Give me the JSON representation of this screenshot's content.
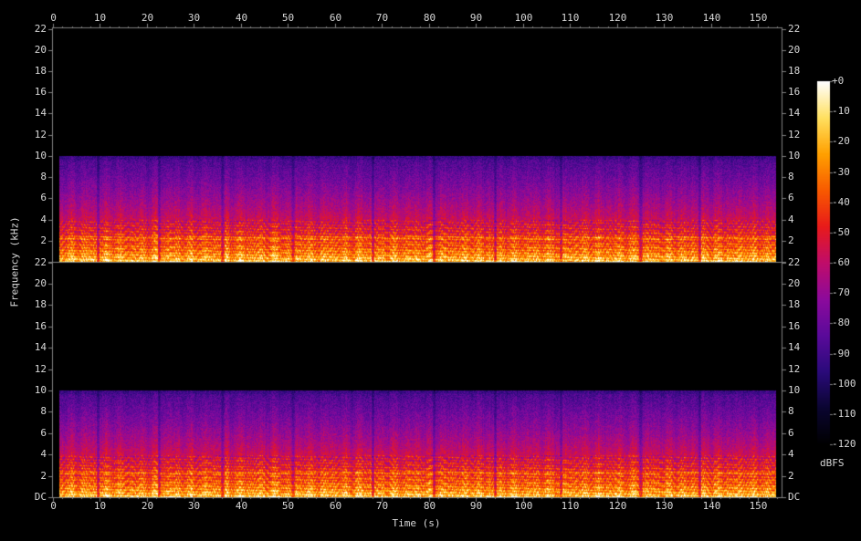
{
  "chart_data": {
    "type": "heatmap",
    "kind": "spectrogram",
    "channels": 2,
    "xlabel": "Time (s)",
    "ylabel": "Frequency (kHz)",
    "x_ticks": [
      0,
      10,
      20,
      30,
      40,
      50,
      60,
      70,
      80,
      90,
      100,
      110,
      120,
      130,
      140,
      150
    ],
    "xlim": [
      0,
      155
    ],
    "y_ticks": [
      "DC",
      "2",
      "4",
      "6",
      "8",
      "10",
      "12",
      "14",
      "16",
      "18",
      "20",
      "22"
    ],
    "y_tick_values": [
      0,
      2,
      4,
      6,
      8,
      10,
      12,
      14,
      16,
      18,
      20,
      22
    ],
    "ylim": [
      0,
      22.05
    ],
    "content_time_range": [
      1.2,
      153.8
    ],
    "content_bandwidth_khz": 10,
    "colorbar": {
      "unit": "dBFS",
      "ticks": [
        "+0",
        "-10",
        "-20",
        "-30",
        "-40",
        "-50",
        "-60",
        "-70",
        "-80",
        "-90",
        "-100",
        "-110",
        "-120"
      ],
      "tick_values": [
        0,
        -10,
        -20,
        -30,
        -40,
        -50,
        -60,
        -70,
        -80,
        -90,
        -100,
        -110,
        -120
      ],
      "range": [
        -120,
        0
      ]
    },
    "pause_times_s": [
      9.5,
      22.5,
      36,
      51,
      68,
      81,
      94,
      108,
      125,
      137.5
    ],
    "colors": {
      "background": "#000000",
      "text": "#d8d8d8",
      "axis": "#808080",
      "palette": [
        "#000000",
        "#0a0530",
        "#2a0a7a",
        "#5a0a9a",
        "#8c0a9c",
        "#c00c6a",
        "#e81a1a",
        "#f85a00",
        "#ffa000",
        "#ffe060",
        "#ffffff"
      ]
    }
  }
}
